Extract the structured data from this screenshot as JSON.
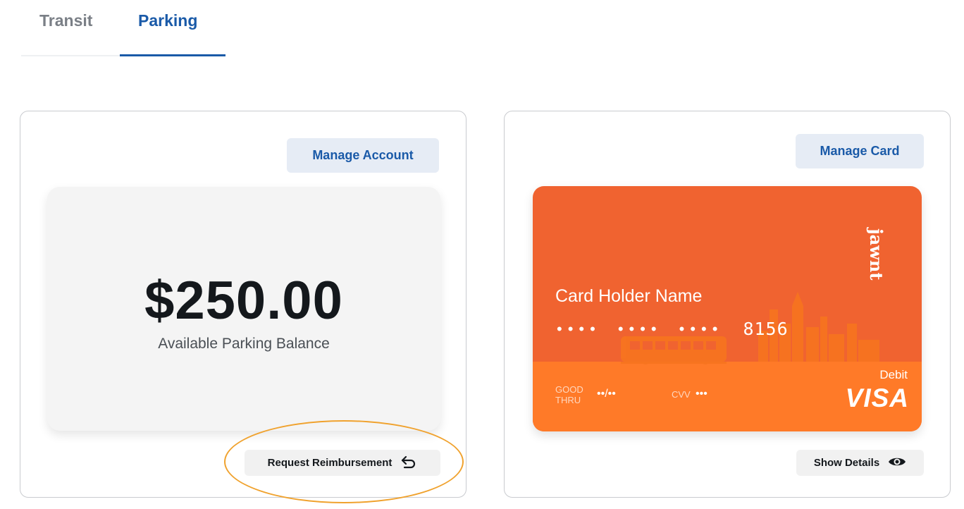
{
  "tabs": [
    {
      "label": "Transit",
      "active": false
    },
    {
      "label": "Parking",
      "active": true
    }
  ],
  "balance_panel": {
    "manage_button": "Manage Account",
    "amount": "$250.00",
    "label": "Available Parking Balance",
    "action_button": "Request Reimbursement",
    "action_icon": "undo-arrow-icon"
  },
  "card_panel": {
    "manage_button": "Manage Card",
    "card": {
      "brand": "jawnt",
      "holder_name": "Card Holder Name",
      "masked_groups": [
        "••••",
        "••••",
        "••••"
      ],
      "last4": "8156",
      "good_thru_label": "GOOD\nTHRU",
      "expiry": "••/••",
      "cvv_label": "CVV",
      "cvv": "•••",
      "type": "Debit",
      "network": "VISA"
    },
    "action_button": "Show Details",
    "action_icon": "eye-icon"
  },
  "colors": {
    "accent": "#1a5aa8",
    "card_top": "#f06330",
    "card_bottom": "#ff7a28",
    "highlight": "#f0a22e"
  }
}
